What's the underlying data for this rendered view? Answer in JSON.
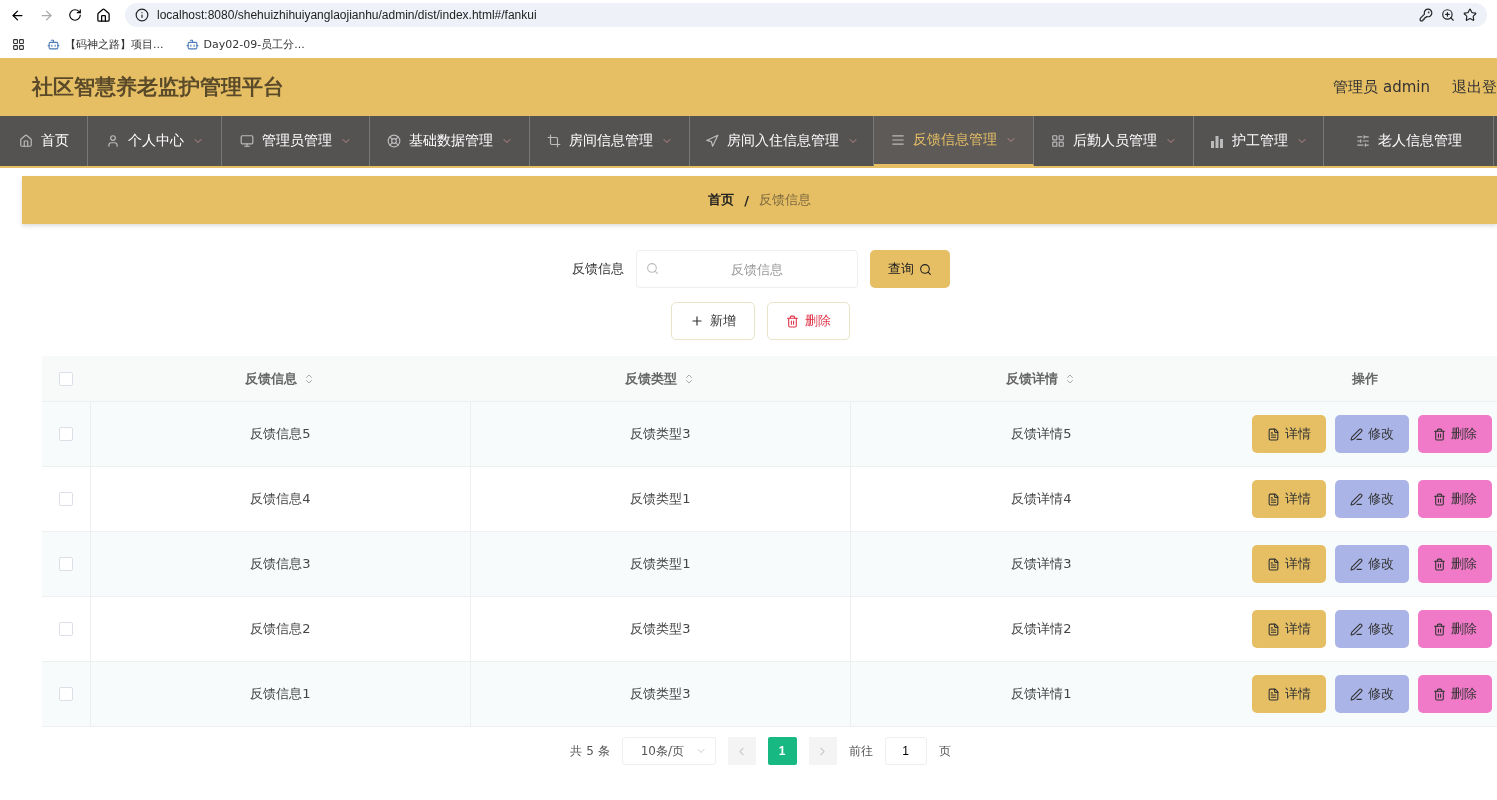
{
  "browser": {
    "url": "localhost:8080/shehuizhihuiyanglaojianhu/admin/dist/index.html#/fankui",
    "bookmarks": [
      "【码神之路】项目...",
      "Day02-09-员工分..."
    ]
  },
  "header": {
    "title": "社区智慧养老监护管理平台",
    "user": "管理员 admin",
    "logout": "退出登"
  },
  "nav": [
    {
      "label": "首页",
      "selected": false,
      "dropdown": false
    },
    {
      "label": "个人中心",
      "selected": false,
      "dropdown": true
    },
    {
      "label": "管理员管理",
      "selected": false,
      "dropdown": true
    },
    {
      "label": "基础数据管理",
      "selected": false,
      "dropdown": true
    },
    {
      "label": "房间信息管理",
      "selected": false,
      "dropdown": true
    },
    {
      "label": "房间入住信息管理",
      "selected": false,
      "dropdown": true
    },
    {
      "label": "反馈信息管理",
      "selected": true,
      "dropdown": true
    },
    {
      "label": "后勤人员管理",
      "selected": false,
      "dropdown": true
    },
    {
      "label": "护工管理",
      "selected": false,
      "dropdown": true
    },
    {
      "label": "老人信息管理",
      "selected": false,
      "dropdown": false
    }
  ],
  "breadcrumb": {
    "separator": "/",
    "items": [
      {
        "label": "首页",
        "current": false
      },
      {
        "label": "反馈信息",
        "current": true
      }
    ]
  },
  "search": {
    "label": "反馈信息",
    "placeholder": "反馈信息",
    "button": "查询"
  },
  "actions": [
    {
      "label": "新增",
      "kind": "add"
    },
    {
      "label": "删除",
      "kind": "delete"
    }
  ],
  "table": {
    "select_all": {
      "checked": false
    },
    "columns": [
      {
        "label": "反馈信息",
        "sortable": true
      },
      {
        "label": "反馈类型",
        "sortable": true
      },
      {
        "label": "反馈详情",
        "sortable": true
      },
      {
        "label": "操作",
        "sortable": false
      }
    ],
    "rows": [
      {
        "checked": false,
        "cells": [
          "反馈信息5",
          "反馈类型3",
          "反馈详情5"
        ],
        "actions": [
          {
            "label": "详情",
            "kind": "detail"
          },
          {
            "label": "修改",
            "kind": "edit"
          },
          {
            "label": "删除",
            "kind": "delete"
          }
        ]
      },
      {
        "checked": false,
        "cells": [
          "反馈信息4",
          "反馈类型1",
          "反馈详情4"
        ],
        "actions": [
          {
            "label": "详情",
            "kind": "detail"
          },
          {
            "label": "修改",
            "kind": "edit"
          },
          {
            "label": "删除",
            "kind": "delete"
          }
        ]
      },
      {
        "checked": false,
        "cells": [
          "反馈信息3",
          "反馈类型1",
          "反馈详情3"
        ],
        "actions": [
          {
            "label": "详情",
            "kind": "detail"
          },
          {
            "label": "修改",
            "kind": "edit"
          },
          {
            "label": "删除",
            "kind": "delete"
          }
        ]
      },
      {
        "checked": false,
        "cells": [
          "反馈信息2",
          "反馈类型3",
          "反馈详情2"
        ],
        "actions": [
          {
            "label": "详情",
            "kind": "detail"
          },
          {
            "label": "修改",
            "kind": "edit"
          },
          {
            "label": "删除",
            "kind": "delete"
          }
        ]
      },
      {
        "checked": false,
        "cells": [
          "反馈信息1",
          "反馈类型3",
          "反馈详情1"
        ],
        "actions": [
          {
            "label": "详情",
            "kind": "detail"
          },
          {
            "label": "修改",
            "kind": "edit"
          },
          {
            "label": "删除",
            "kind": "delete"
          }
        ]
      }
    ]
  },
  "pagination": {
    "total": "共 5 条",
    "page_size": "10条/页",
    "pages": [
      {
        "label": "1",
        "selected": true
      }
    ],
    "goto_label": "前往",
    "goto_value": "1",
    "goto_suffix": "页"
  }
}
